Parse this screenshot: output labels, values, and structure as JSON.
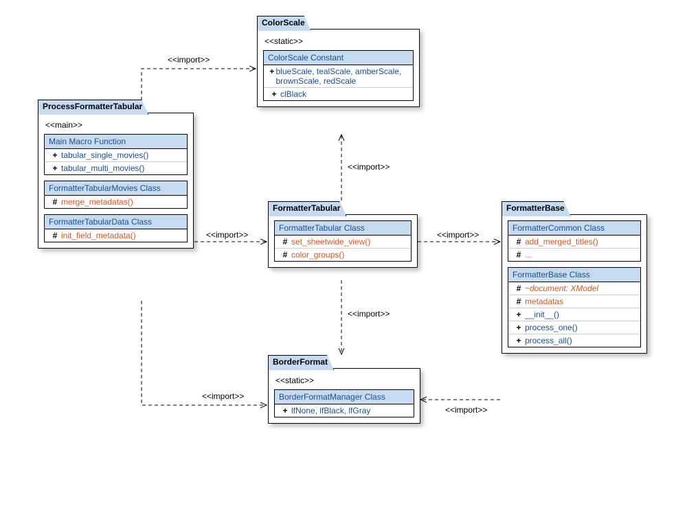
{
  "diagram_type": "UML Package Diagram",
  "stereotypes": {
    "import": "<<import>>",
    "static": "<<static>>",
    "main": "<<main>>"
  },
  "packages": {
    "processFormatterTabular": {
      "name": "ProcessFormatterTabular",
      "stereotype": "<<main>>",
      "classes": [
        {
          "name": "Main Macro Function",
          "members": [
            {
              "vis": "+",
              "text": "tabular_single_movies()",
              "kind": "pub"
            },
            {
              "vis": "+",
              "text": "tabular_multi_movies()",
              "kind": "pub"
            }
          ]
        },
        {
          "name": "FormatterTabularMovies Class",
          "members": [
            {
              "vis": "#",
              "text": "merge_metadatas()",
              "kind": "pro"
            }
          ]
        },
        {
          "name": "FormatterTabularData Class",
          "members": [
            {
              "vis": "#",
              "text": "init_field_metadata()",
              "kind": "pro"
            }
          ]
        }
      ]
    },
    "colorScale": {
      "name": "ColorScale",
      "stereotype": "<<static>>",
      "classes": [
        {
          "name": "ColorScale Constant",
          "members": [
            {
              "vis": "+",
              "text": "blueScale, tealScale, amberScale, brownScale, redScale",
              "kind": "pub"
            },
            {
              "vis": "+",
              "text": "clBlack",
              "kind": "pub"
            }
          ]
        }
      ]
    },
    "formatterTabular": {
      "name": "FormatterTabular",
      "classes": [
        {
          "name": "FormatterTabular Class",
          "members": [
            {
              "vis": "#",
              "text": "set_sheetwide_view()",
              "kind": "pro"
            },
            {
              "vis": "#",
              "text": "color_groups()",
              "kind": "pro"
            }
          ]
        }
      ]
    },
    "formatterBase": {
      "name": "FormatterBase",
      "classes": [
        {
          "name": "FormatterCommon Class",
          "members": [
            {
              "vis": "#",
              "text": "add_merged_titles()",
              "kind": "pro"
            },
            {
              "vis": "#",
              "text": "...",
              "kind": "pro"
            }
          ]
        },
        {
          "name": "FormatterBase Class",
          "members": [
            {
              "vis": "#",
              "text": "~document: XModel",
              "kind": "pro",
              "italic": true
            },
            {
              "vis": "#",
              "text": "metadatas",
              "kind": "pro"
            },
            {
              "vis": "+",
              "text": "__init__()",
              "kind": "pub"
            },
            {
              "vis": "+",
              "text": "process_one()",
              "kind": "pub"
            },
            {
              "vis": "+",
              "text": "process_all()",
              "kind": "pub"
            }
          ]
        }
      ]
    },
    "borderFormat": {
      "name": "BorderFormat",
      "stereotype": "<<static>>",
      "classes": [
        {
          "name": "BorderFormatManager Class",
          "members": [
            {
              "vis": "+",
              "text": "lfNone, lfBlack, lfGray",
              "kind": "pub"
            }
          ]
        }
      ]
    }
  },
  "relationships": [
    {
      "from": "ProcessFormatterTabular",
      "to": "ColorScale",
      "type": "import"
    },
    {
      "from": "ProcessFormatterTabular",
      "to": "FormatterTabular",
      "type": "import"
    },
    {
      "from": "ProcessFormatterTabular",
      "to": "BorderFormat",
      "type": "import"
    },
    {
      "from": "FormatterTabular",
      "to": "ColorScale",
      "type": "import"
    },
    {
      "from": "FormatterTabular",
      "to": "FormatterBase",
      "type": "import"
    },
    {
      "from": "FormatterTabular",
      "to": "BorderFormat",
      "type": "import"
    },
    {
      "from": "FormatterBase",
      "to": "BorderFormat",
      "type": "import"
    }
  ]
}
